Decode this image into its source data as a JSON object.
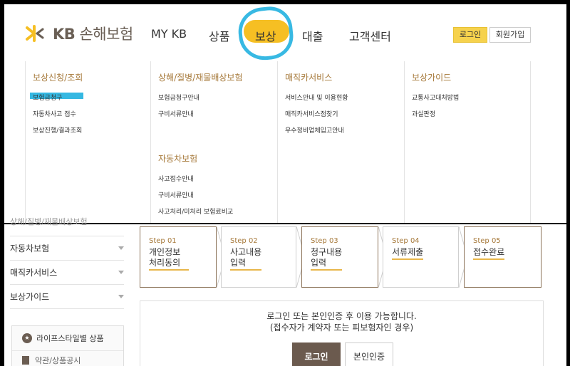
{
  "brand": {
    "logo_kb": "KB",
    "logo_name": "손해보험",
    "logo_color": "#f6bf23"
  },
  "gnb": {
    "items": [
      {
        "label": "MY KB"
      },
      {
        "label": "상품"
      },
      {
        "label": "보상"
      },
      {
        "label": "대출"
      },
      {
        "label": "고객센터"
      }
    ],
    "active_index": 2,
    "login": "로그인",
    "join": "회원가입"
  },
  "mega_menu": {
    "columns": [
      {
        "groups": [
          {
            "title": "보상신청/조회",
            "items": [
              "보험금청구",
              "자동차사고 접수",
              "보상진행/결과조회"
            ]
          }
        ]
      },
      {
        "groups": [
          {
            "title": "상해/질병/재물배상보험",
            "items": [
              "보험금청구안내",
              "구비서류안내"
            ]
          },
          {
            "title": "자동차보험",
            "items": [
              "사고접수안내",
              "구비서류안내",
              "사고처리/미처리 보험료비교"
            ]
          }
        ]
      },
      {
        "groups": [
          {
            "title": "매직카서비스",
            "items": [
              "서비스안내 및 이용현황",
              "매직카서비스점찾기",
              "우수정비업체입고안내"
            ]
          }
        ]
      },
      {
        "groups": [
          {
            "title": "보상가이드",
            "items": [
              "교통사고대처방법",
              "과실판정"
            ]
          }
        ]
      }
    ],
    "highlighted_item": "보험금청구"
  },
  "sidebar": {
    "partial_label": "상해/질병/재물배상보험",
    "items": [
      {
        "label": "자동차보험"
      },
      {
        "label": "매직카서비스"
      },
      {
        "label": "보상가이드"
      }
    ],
    "box": {
      "row1": "라이프스타일별 상품",
      "row2": "약관/상품공시"
    }
  },
  "steps": [
    {
      "step": "Step 01",
      "title_l1": "개인정보",
      "title_l2": "처리동의"
    },
    {
      "step": "Step 02",
      "title_l1": "사고내용",
      "title_l2": "입력"
    },
    {
      "step": "Step 03",
      "title_l1": "청구내용",
      "title_l2": "입력"
    },
    {
      "step": "Step 04",
      "title_l1": "서류제출",
      "title_l2": ""
    },
    {
      "step": "Step 05",
      "title_l1": "접수완료",
      "title_l2": ""
    }
  ],
  "notice": {
    "line1": "로그인 또는 본인인증 후 이용 가능합니다.",
    "line2": "(접수자가 계약자 또는 피보험자인 경우)",
    "login_button": "로그인",
    "cert_button": "본인인증"
  }
}
